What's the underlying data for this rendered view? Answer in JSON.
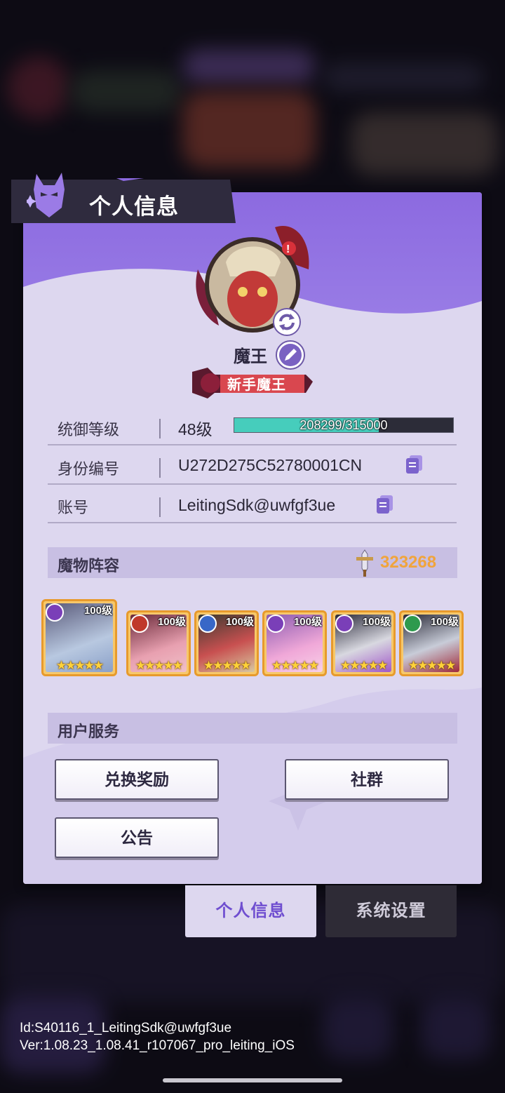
{
  "panel": {
    "title": "个人信息"
  },
  "profile": {
    "name": "魔王",
    "rank_title": "新手魔王"
  },
  "info_rows": {
    "level": {
      "label": "统御等级",
      "value": "48级",
      "xp_text": "208299/315000",
      "xp_current": 208299,
      "xp_max": 315000
    },
    "id": {
      "label": "身份编号",
      "value": "U272D275C52780001CN"
    },
    "account": {
      "label": "账号",
      "value": "LeitingSdk@uwfgf3ue"
    }
  },
  "lineup": {
    "label": "魔物阵容",
    "power": "323268",
    "monsters": [
      {
        "level": "100级",
        "stars": "★★★★★",
        "element_color": "#7a3fb8"
      },
      {
        "level": "100级",
        "stars": "★★★★★",
        "element_color": "#c0392b"
      },
      {
        "level": "100级",
        "stars": "★★★★★",
        "element_color": "#3867c7"
      },
      {
        "level": "100级",
        "stars": "★★★★★",
        "element_color": "#7a3fb8"
      },
      {
        "level": "100级",
        "stars": "★★★★★",
        "element_color": "#7a3fb8"
      },
      {
        "level": "100级",
        "stars": "★★★★★",
        "element_color": "#2e9a4e"
      }
    ]
  },
  "services": {
    "label": "用户服务",
    "redeem": "兑换奖励",
    "community": "社群",
    "notice": "公告"
  },
  "tabs": {
    "profile": "个人信息",
    "settings": "系统设置"
  },
  "footer": {
    "id_line": "Id:S40116_1_LeitingSdk@uwfgf3ue",
    "ver_line": "Ver:1.08.23_1.08.41_r107067_pro_leiting_iOS"
  },
  "colors": {
    "accent": "#8c6ae0",
    "xp_fill": "#46cdbc",
    "power": "#f0a43c",
    "card_border": "#e79a2c"
  }
}
